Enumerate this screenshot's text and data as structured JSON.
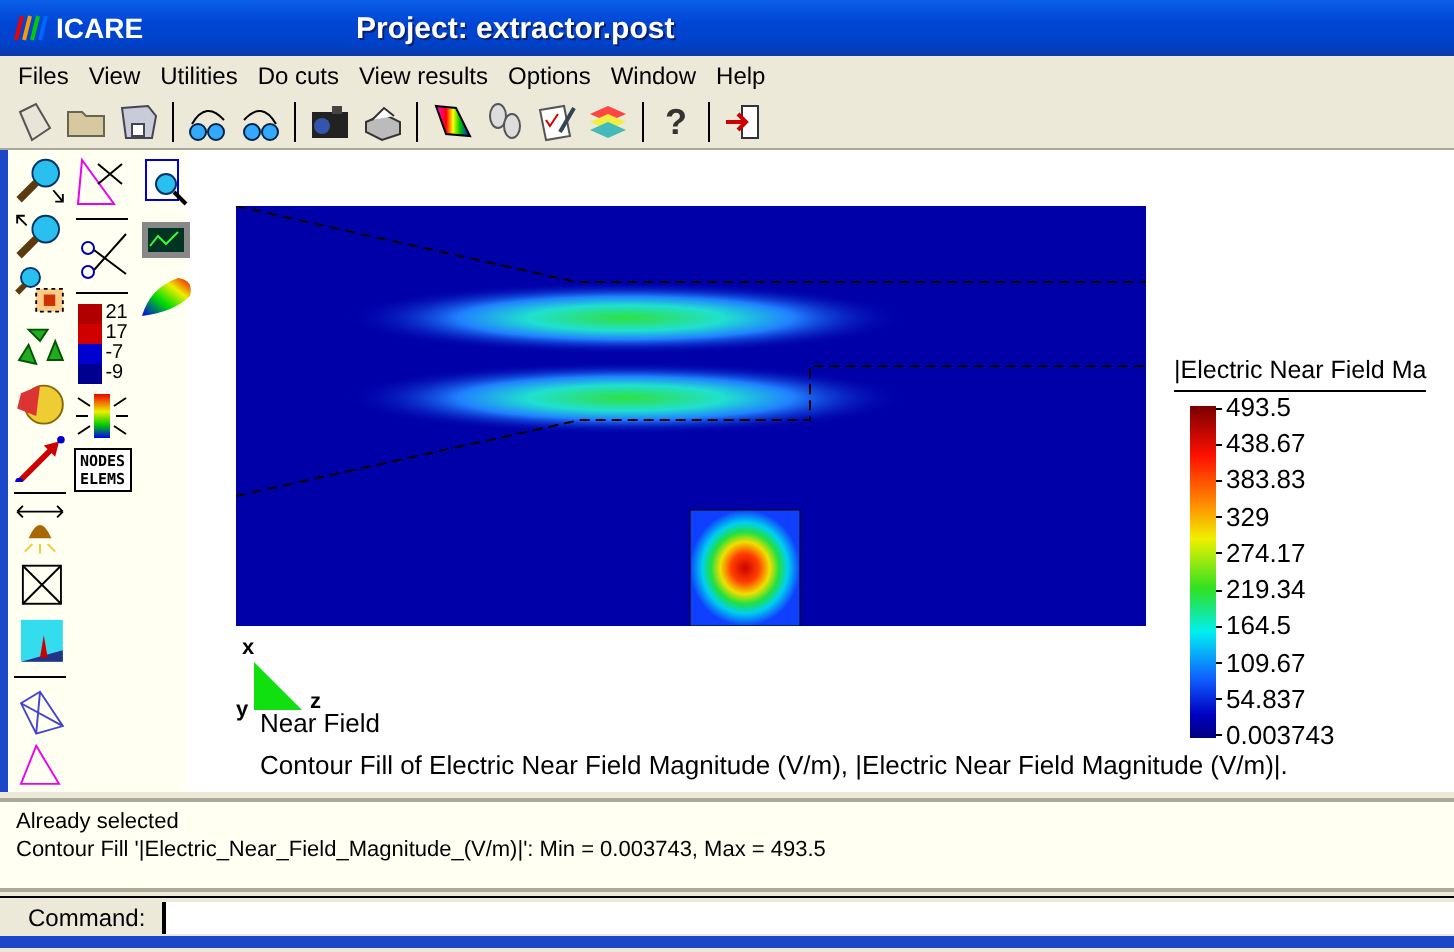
{
  "window": {
    "app_name": "ICARE",
    "title": "Project: extractor.post"
  },
  "menu": [
    {
      "label": "Files"
    },
    {
      "label": "View"
    },
    {
      "label": "Utilities"
    },
    {
      "label": "Do cuts"
    },
    {
      "label": "View results"
    },
    {
      "label": "Options"
    },
    {
      "label": "Window"
    },
    {
      "label": "Help"
    }
  ],
  "toolbar": {
    "help_glyph": "?"
  },
  "side_panel": {
    "scale_labels": [
      "21",
      "17",
      "-7",
      "-9"
    ],
    "nodes_elems_lines": [
      "NODES",
      "ELEMS"
    ]
  },
  "plot": {
    "axes": {
      "x": "x",
      "y": "y",
      "z": "z"
    },
    "legend_title": "|Electric Near Field Ma",
    "legend_ticks": [
      "493.5",
      "438.67",
      "383.83",
      "329",
      "274.17",
      "219.34",
      "164.5",
      "109.67",
      "54.837",
      "0.003743"
    ],
    "captions": [
      "Near Field",
      "Contour Fill of Electric Near Field Magnitude (V/m), |Electric Near Field Magnitude (V/m)|."
    ]
  },
  "messages": [
    "Already selected",
    "Contour Fill '|Electric_Near_Field_Magnitude_(V/m)|': Min = 0.003743, Max = 493.5"
  ],
  "command": {
    "label": "Command:"
  }
}
